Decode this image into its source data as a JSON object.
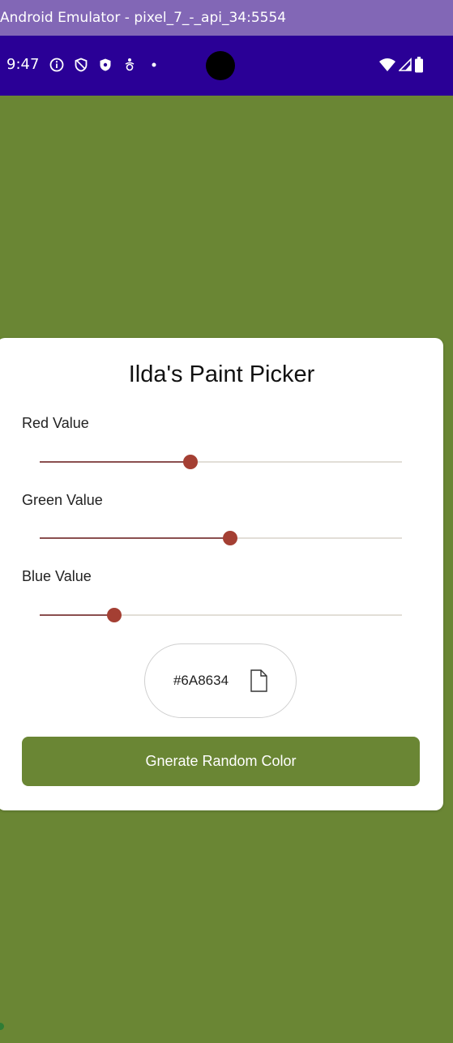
{
  "emulator": {
    "title": "Android Emulator - pixel_7_-_api_34:5554"
  },
  "status_bar": {
    "time": "9:47",
    "icons_left": [
      "info-icon",
      "shield-outline-icon",
      "shield-filled-icon",
      "accessibility-icon",
      "dot-icon"
    ],
    "icons_right": [
      "wifi-icon",
      "signal-icon",
      "battery-icon"
    ]
  },
  "app": {
    "background_color": "#6A8634",
    "title": "Ilda's Paint Picker",
    "sliders": [
      {
        "label": "Red Value",
        "value_fraction": 0.415
      },
      {
        "label": "Green Value",
        "value_fraction": 0.525
      },
      {
        "label": "Blue Value",
        "value_fraction": 0.205
      }
    ],
    "hex_value": "#6A8634",
    "copy_icon": "copy-icon",
    "generate_button_label": "Gnerate Random Color"
  },
  "colors": {
    "card_bg": "#FFFFFF",
    "slider_thumb": "#A43F33",
    "slider_fill": "#8A4F4F",
    "status_bar": "#2A0096",
    "title_bar": "#8267B6"
  }
}
